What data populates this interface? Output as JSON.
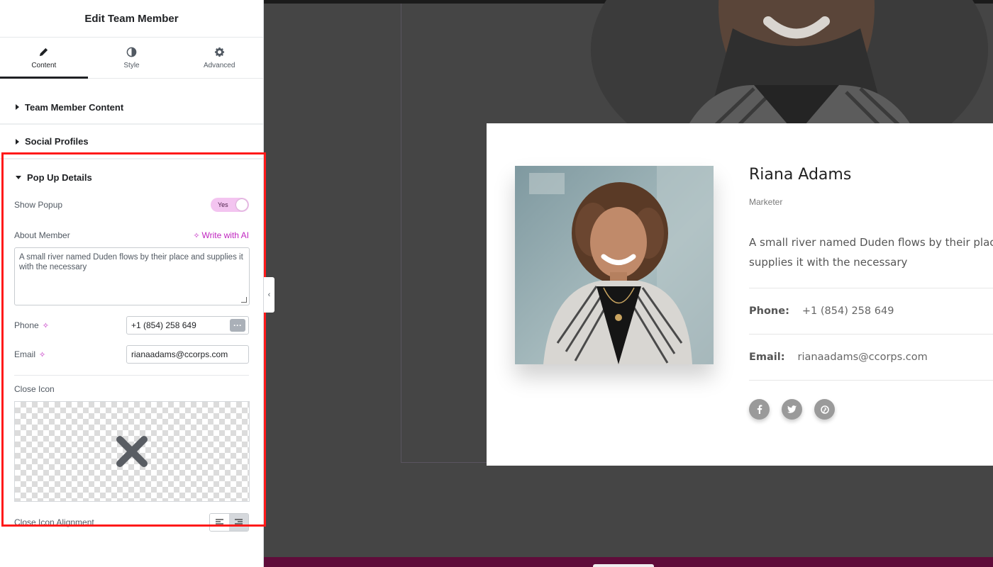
{
  "panel": {
    "title": "Edit Team Member",
    "tabs": [
      {
        "label": "Content",
        "icon": "pencil-icon"
      },
      {
        "label": "Style",
        "icon": "half-circle-icon"
      },
      {
        "label": "Advanced",
        "icon": "gear-icon"
      }
    ],
    "sections": [
      "Team Member Content",
      "Social Profiles"
    ],
    "popup": {
      "title": "Pop Up Details",
      "show_popup_label": "Show Popup",
      "show_popup_value": "Yes",
      "about_label": "About Member",
      "write_ai": "Write with AI",
      "about_text": "A small river named Duden flows by their place and supplies it with the necessary",
      "phone_label": "Phone",
      "phone_value": "+1 (854) 258 649",
      "email_label": "Email",
      "email_value": "rianaadams@ccorps.com",
      "close_icon_label": "Close Icon",
      "close_icon_alignment_label": "Close Icon Alignment"
    }
  },
  "card": {
    "name": "Riana Adams",
    "role": "Marketer",
    "about": "A small river named Duden flows by their place and supplies it with the necessary",
    "phone_label": "Phone:",
    "phone": "+1 (854) 258 649",
    "email_label": "Email:",
    "email": "rianaadams@ccorps.com",
    "socials": [
      "facebook-icon",
      "twitter-icon",
      "pinterest-icon"
    ]
  },
  "colors": {
    "accent": "#c026c0",
    "highlight": "#ff1a1a",
    "toggle_bg": "#f3c4f0",
    "preview_bg": "#454545",
    "footer_bar": "#5f0c3a"
  }
}
